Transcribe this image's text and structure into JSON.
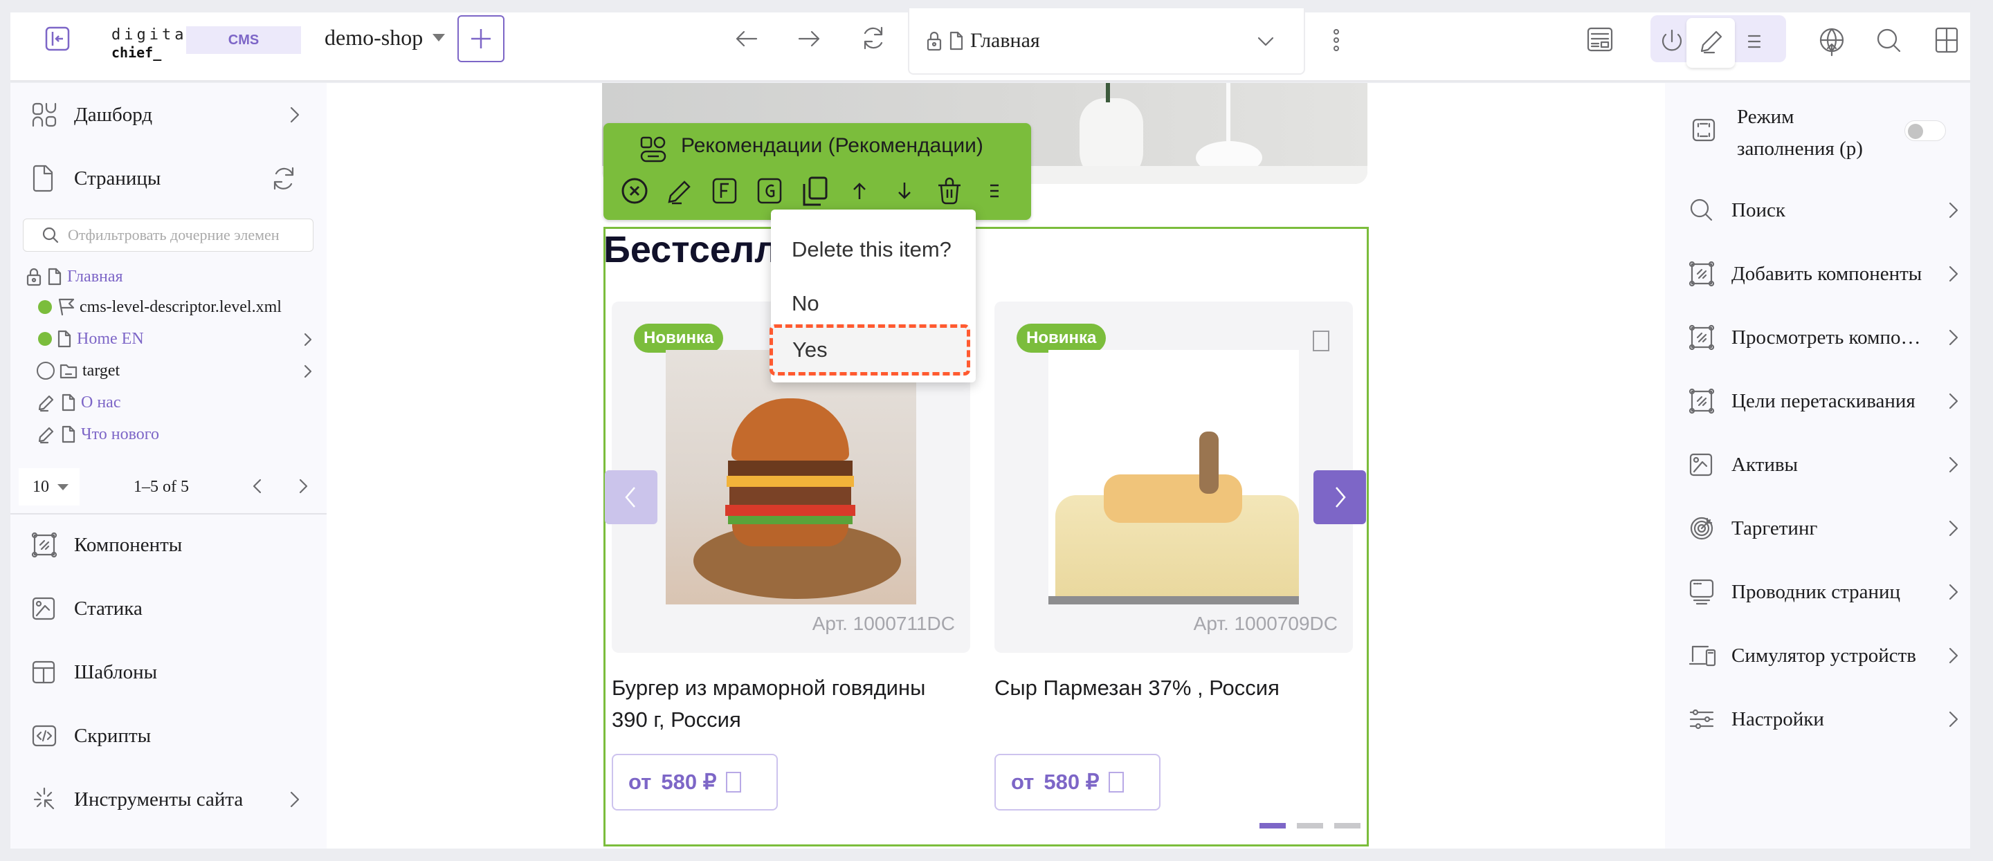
{
  "topbar": {
    "logo_line1": "digital",
    "logo_line2": "chief_",
    "cms_badge": "CMS",
    "site_selector": "demo-shop",
    "url_label": "Главная",
    "icons": [
      "collapse-sidebar-icon",
      "plus-icon",
      "back-arrow-icon",
      "forward-arrow-icon",
      "refresh-icon",
      "lock-icon",
      "page-icon",
      "chevron-down-icon",
      "more-vertical-icon",
      "layout-icon",
      "power-icon",
      "pencil-icon",
      "list-icon",
      "globe-publish-icon",
      "search-icon",
      "grid-icon"
    ]
  },
  "left_sidebar": {
    "dashboard": "Дашборд",
    "pages": "Страницы",
    "filter_placeholder": "Отфильтровать дочерние элемен",
    "tree": [
      {
        "label": "Главная",
        "status": "locked",
        "link": true
      },
      {
        "label": "cms-level-descriptor.level.xml",
        "status": "published",
        "link": false
      },
      {
        "label": "Home EN",
        "status": "published",
        "link": true,
        "expandable": true
      },
      {
        "label": "target",
        "status": "none",
        "link": false,
        "expandable": true,
        "type": "folder"
      },
      {
        "label": "О нас",
        "status": "edited",
        "link": true
      },
      {
        "label": "Что нового",
        "status": "edited",
        "link": true
      }
    ],
    "pager": {
      "per_page": "10",
      "range": "1–5 of 5"
    },
    "sections": [
      "Компоненты",
      "Статика",
      "Шаблоны",
      "Скрипты",
      "Инструменты сайта"
    ]
  },
  "content": {
    "component_toolbar": {
      "title": "Рекомендации (Рекомендации)",
      "actions": [
        "close-circle-icon",
        "pencil-icon",
        "form-f-icon",
        "group-g-icon",
        "copy-icon",
        "arrow-up-icon",
        "arrow-down-icon",
        "trash-icon",
        "menu-icon"
      ]
    },
    "section_title": "Бестселл",
    "delete_popup": {
      "question": "Delete this item?",
      "no": "No",
      "yes": "Yes"
    },
    "products": [
      {
        "badge": "Новинка",
        "article": "Арт. 1000711DC",
        "name_line1": "Бургер из мраморной говядины",
        "name_line2": "390 г, Россия",
        "price_prefix": "от",
        "price": "580 ₽"
      },
      {
        "badge": "Новинка",
        "article": "Арт. 1000709DC",
        "name_line1": "Сыр Пармезан 37% , Россия",
        "name_line2": "",
        "price_prefix": "от",
        "price": "580 ₽"
      }
    ],
    "carousel": {
      "pages": 3,
      "active_page": 1
    },
    "colors": {
      "accent": "#7d66c7",
      "highlight_green": "#7bbd3c",
      "confirm_outline": "#ff5a30"
    }
  },
  "right_sidebar": {
    "fill_mode": "Режим заполнения (р)",
    "fill_mode_line1": "Режим",
    "fill_mode_line2": "заполнения (р)",
    "fill_mode_on": false,
    "items": [
      "Поиск",
      "Добавить компоненты",
      "Просмотреть компоненты",
      "Цели перетаскивания",
      "Активы",
      "Таргетинг",
      "Проводник страниц",
      "Симулятор устройств",
      "Настройки"
    ]
  }
}
